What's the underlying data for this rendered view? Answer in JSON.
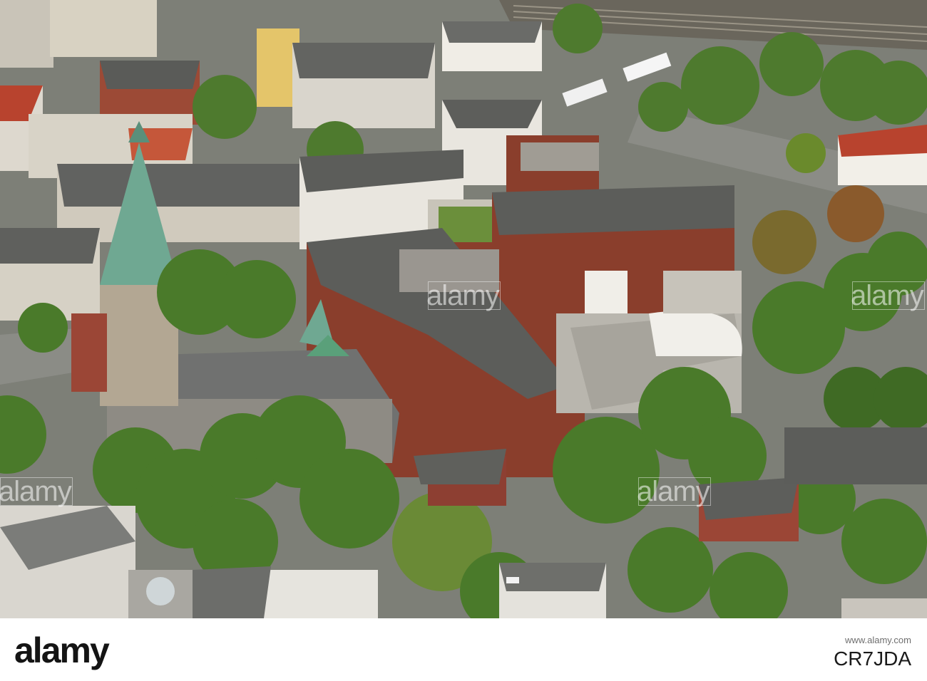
{
  "photo": {
    "subject": "aerial-view-town-church-clinic",
    "watermarks": [
      "alamy",
      "alamy",
      "alamy",
      "alamy"
    ]
  },
  "footer": {
    "logo": "alamy",
    "label": "www.alamy.com",
    "image_id": "CR7JDA"
  },
  "colors": {
    "background": "#ffffff",
    "roof_grey": "#5c5d5a",
    "brick": "#8a3e2c",
    "tree_green": "#4a7a2a",
    "copper_spire": "#6fa892"
  }
}
